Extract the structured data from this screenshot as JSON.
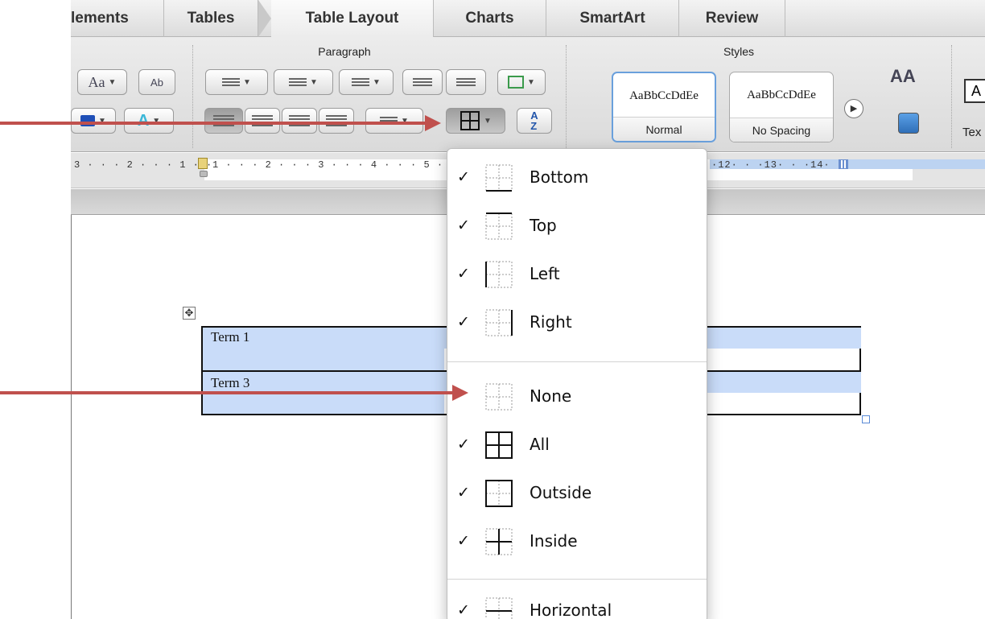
{
  "tabs": [
    {
      "label": "lements",
      "active": false
    },
    {
      "label": "Tables",
      "active": false
    },
    {
      "label": "Table Layout",
      "active": true
    },
    {
      "label": "Charts",
      "active": false
    },
    {
      "label": "SmartArt",
      "active": false
    },
    {
      "label": "Review",
      "active": false
    }
  ],
  "ribbon": {
    "paragraph_group_title": "Paragraph",
    "styles_group_title": "Styles",
    "styles": [
      {
        "sample": "AaBbCcDdEe",
        "name": "Normal",
        "selected": true
      },
      {
        "sample": "AaBbCcDdEe",
        "name": "No Spacing",
        "selected": false
      }
    ],
    "text_box_label": "Tex"
  },
  "ruler": {
    "left_numbers": "3 · · · 2 · · · 1 · ·",
    "right_numbers_a": "1 · · · 2 · · · 3 · · · 4 · · · 5 ·",
    "right_numbers_b": "·12· · ·13· · ·14· ·"
  },
  "table": {
    "cells": [
      "Term 1",
      "Term 3"
    ],
    "selection_color": "#c9dcf9"
  },
  "borders_menu": {
    "items": [
      {
        "label": "Bottom",
        "checked": true,
        "icon": "border-bottom-icon"
      },
      {
        "label": "Top",
        "checked": true,
        "icon": "border-top-icon"
      },
      {
        "label": "Left",
        "checked": true,
        "icon": "border-left-icon"
      },
      {
        "label": "Right",
        "checked": true,
        "icon": "border-right-icon"
      },
      {
        "label": "None",
        "checked": false,
        "icon": "border-none-icon"
      },
      {
        "label": "All",
        "checked": true,
        "icon": "border-all-icon"
      },
      {
        "label": "Outside",
        "checked": true,
        "icon": "border-outside-icon"
      },
      {
        "label": "Inside",
        "checked": true,
        "icon": "border-inside-icon"
      },
      {
        "label": "Horizontal",
        "checked": true,
        "icon": "border-horizontal-icon"
      }
    ],
    "check_glyph": "✓"
  },
  "annotation_color": "#c0504d"
}
